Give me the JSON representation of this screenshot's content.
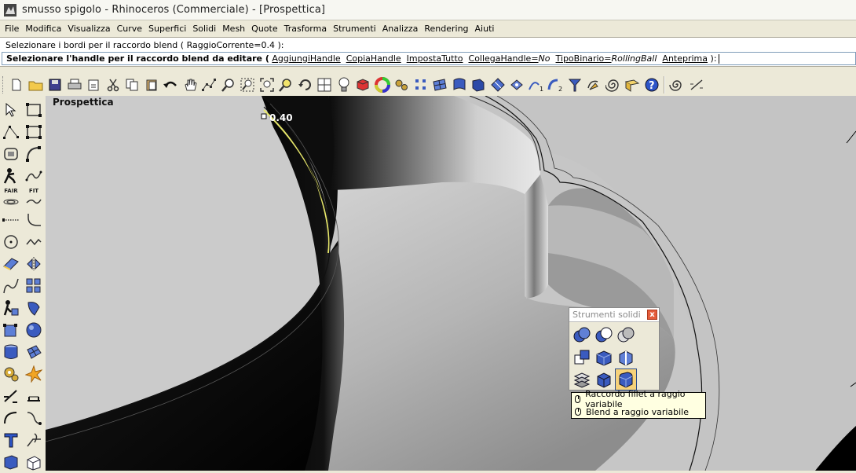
{
  "window": {
    "title": "smusso spigolo - Rhinoceros (Commerciale) - [Prospettica]",
    "icon": "rhino-app-icon"
  },
  "menu": [
    "File",
    "Modifica",
    "Visualizza",
    "Curve",
    "Superfici",
    "Solidi",
    "Mesh",
    "Quote",
    "Trasforma",
    "Strumenti",
    "Analizza",
    "Rendering",
    "Aiuti"
  ],
  "command": {
    "history_line": "Selezionare i bordi per il raccordo blend ( RaggioCorrente=0.4 ):",
    "prompt": {
      "text": "Selezionare l'handle per il raccordo blend da editare (",
      "opt_add": "AggiungiHandle",
      "opt_copy": "CopiaHandle",
      "opt_setall": "ImpostaTutto",
      "opt_link": "CollegaHandle=",
      "opt_link_val": "No",
      "opt_rail": "TipoBinario=",
      "opt_rail_val": "RollingBall",
      "opt_preview": "Anteprima",
      "end": " ):"
    }
  },
  "viewport": {
    "name": "Prospettica",
    "dimension_label": "0.40"
  },
  "left_labels": {
    "fair": "FAIR",
    "fit": "FIT"
  },
  "palette": {
    "title": "Strumenti solidi",
    "close_glyph": "x"
  },
  "tooltip": {
    "item1": "Raccordo fillet a raggio variabile",
    "item2": "Blend a raggio variabile"
  },
  "colors": {
    "selected_edge": "#e8e84a",
    "surface_dark": "#000000",
    "viewport_bg": "#c5c5c5",
    "icon_blue": "#3a5bbf"
  }
}
